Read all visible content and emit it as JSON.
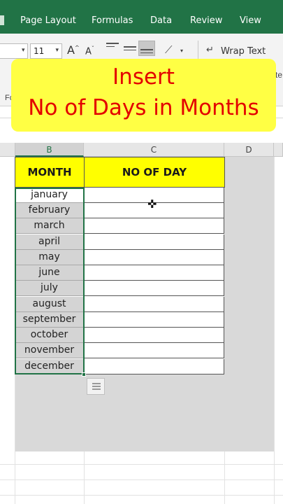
{
  "ribbon": {
    "tabs": [
      "Page Layout",
      "Formulas",
      "Data",
      "Review",
      "View"
    ],
    "font_size": "11",
    "wrap_text_label": "Wrap Text",
    "group_label_partial": "Fo",
    "right_cut_text": "te"
  },
  "banner": {
    "line1": "Insert",
    "line2": "No of Days in Months"
  },
  "sheet": {
    "columns": [
      "B",
      "C",
      "D"
    ],
    "selected_column": "B",
    "headers": {
      "month": "MONTH",
      "days": "NO OF DAY"
    },
    "months": [
      "january",
      "february",
      "march",
      "april",
      "may",
      "june",
      "july",
      "august",
      "september",
      "october",
      "november",
      "december"
    ]
  },
  "colors": {
    "excel_green": "#217346",
    "header_fill": "#ffff00",
    "banner_fill": "#ffff44",
    "banner_text": "#e30000"
  }
}
